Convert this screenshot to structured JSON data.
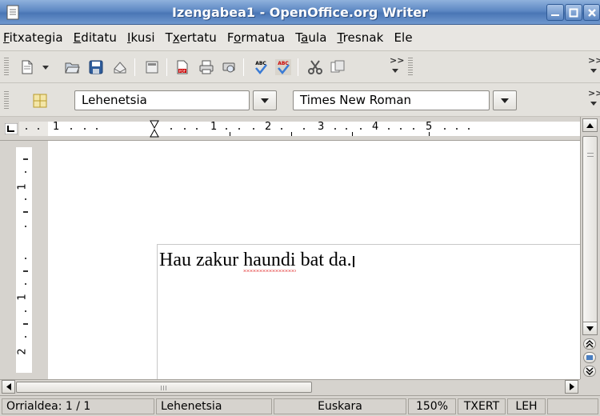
{
  "window": {
    "title": "Izengabea1 - OpenOffice.org Writer"
  },
  "menu": {
    "items": [
      {
        "before": "",
        "key": "F",
        "after": "itxategia"
      },
      {
        "before": "",
        "key": "E",
        "after": "ditatu"
      },
      {
        "before": "",
        "key": "I",
        "after": "kusi"
      },
      {
        "before": "T",
        "key": "x",
        "after": "ertatu"
      },
      {
        "before": "F",
        "key": "o",
        "after": "rmatua"
      },
      {
        "before": "T",
        "key": "a",
        "after": "ula"
      },
      {
        "before": "",
        "key": "T",
        "after": "resnak"
      },
      {
        "before": "Ele",
        "key": "",
        "after": ""
      }
    ]
  },
  "format_toolbar": {
    "style_value": "Lehenetsia",
    "font_value": "Times New Roman"
  },
  "ruler": {
    "labels": [
      "1",
      "1",
      "2",
      "3",
      "4",
      "5"
    ],
    "vlabels": [
      "1",
      "1",
      "2"
    ]
  },
  "document": {
    "text_before": "Hau zakur ",
    "misspelled_word": "haundi",
    "text_after": " bat da."
  },
  "statusbar": {
    "page": "Orrialdea: 1 / 1",
    "page_style": "Lehenetsia",
    "language": "Euskara",
    "zoom": "150%",
    "insert_mode": "TXERT",
    "selection_mode": "LEH"
  },
  "icons": {
    "app": "document-icon",
    "toolbar_std": [
      "new-document-icon",
      "open-icon",
      "save-icon",
      "email-icon",
      "edit-file-icon",
      "export-pdf-icon",
      "print-icon",
      "print-preview-icon",
      "spellcheck-icon",
      "autospellcheck-icon",
      "cut-icon",
      "copy-icon"
    ],
    "toolbar_fmt": [
      "styles-icon"
    ]
  },
  "colors": {
    "titlebar": "#5d88c3",
    "spell_underline": "#dd0000"
  }
}
